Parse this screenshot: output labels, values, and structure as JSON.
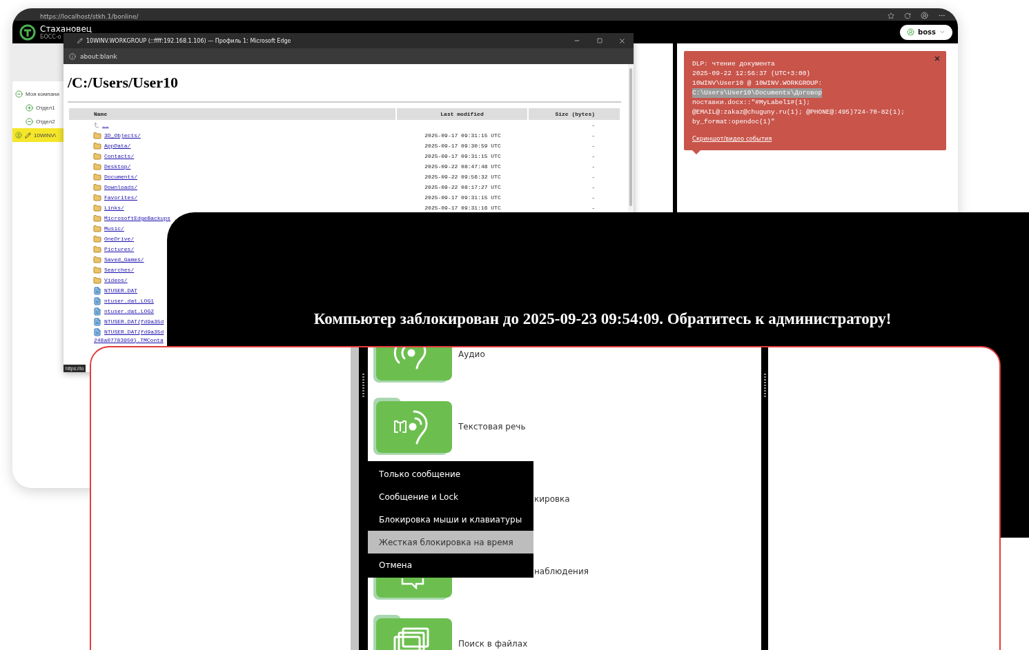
{
  "browser": {
    "url": "https://localhost/stkh.1/bonline/"
  },
  "app": {
    "name": "Стахановец",
    "subtitle": "БОСС-о",
    "user": "boss"
  },
  "tree": [
    {
      "label": "Моя компани",
      "expanded": true,
      "selected": false,
      "children": [
        {
          "label": "Отдел1",
          "expanded": false,
          "selected": false
        },
        {
          "label": "Отдел2",
          "expanded": true,
          "selected": false
        }
      ]
    },
    {
      "label": "10WINV\\",
      "kind": "computer",
      "selected": true
    }
  ],
  "notification": {
    "lines": [
      {
        "text": "DLP: чтение документа",
        "highlighted": false
      },
      {
        "text": "2025-09-22 12:56:37 (UTC+3:00)",
        "highlighted": false
      },
      {
        "text": "10WINV\\User10 @ 10WINV.WORKGROUP:",
        "highlighted": false
      },
      {
        "text": "C:\\Users\\User10\\Documents\\Договор",
        "highlighted": true
      },
      {
        "text": "поставки.docx::\"#MyLabel1#(1);",
        "highlighted": false
      },
      {
        "text": "@EMAIL@:zakaz@chuguny.ru(1); @PHONE@:495)724-70-82(1);",
        "highlighted": false
      },
      {
        "text": "by_format:opendoc(1)\"",
        "highlighted": false
      }
    ],
    "link": "Скриншот/видео события"
  },
  "edge": {
    "title": "10WINV.WORKGROUP (::ffff:192.168.1.106) — Профиль 1: Microsoft Edge",
    "address": "about:blank",
    "heading": "/C:/Users/User10",
    "status": "https://lo",
    "columns": [
      "Name",
      "Last modified",
      "Size (bytes)"
    ],
    "rows": [
      {
        "kind": "parent",
        "name": "..",
        "size": "-"
      },
      {
        "kind": "folder",
        "name": "3D_Objects/",
        "modified": "2025-09-17 09:31:15 UTC",
        "size": "-"
      },
      {
        "kind": "folder",
        "name": "AppData/",
        "modified": "2025-09-17 09:30:59 UTC",
        "size": "-"
      },
      {
        "kind": "folder",
        "name": "Contacts/",
        "modified": "2025-09-17 09:31:15 UTC",
        "size": "-"
      },
      {
        "kind": "folder",
        "name": "Desktop/",
        "modified": "2025-09-22 08:47:48 UTC",
        "size": "-"
      },
      {
        "kind": "folder",
        "name": "Documents/",
        "modified": "2025-09-22 09:56:32 UTC",
        "size": "-"
      },
      {
        "kind": "folder",
        "name": "Downloads/",
        "modified": "2025-09-22 08:17:27 UTC",
        "size": "-"
      },
      {
        "kind": "folder",
        "name": "Favorites/",
        "modified": "2025-09-17 09:31:15 UTC",
        "size": "-"
      },
      {
        "kind": "folder",
        "name": "Links/",
        "modified": "2025-09-17 09:31:16 UTC",
        "size": "-"
      },
      {
        "kind": "folder",
        "name": "MicrosoftEdgeBackups"
      },
      {
        "kind": "folder",
        "name": "Music/"
      },
      {
        "kind": "folder",
        "name": "OneDrive/"
      },
      {
        "kind": "folder",
        "name": "Pictures/"
      },
      {
        "kind": "folder",
        "name": "Saved_Games/"
      },
      {
        "kind": "folder",
        "name": "Searches/"
      },
      {
        "kind": "folder",
        "name": "Videos/"
      },
      {
        "kind": "file",
        "name": "NTUSER.DAT"
      },
      {
        "kind": "file",
        "name": "ntuser.dat.LOG1"
      },
      {
        "kind": "file",
        "name": "ntuser.dat.LOG2"
      },
      {
        "kind": "file",
        "name": "NTUSER.DAT{fd9a35d"
      },
      {
        "kind": "file",
        "name": "NTUSER.DAT{fd9a35d",
        "name_line_2": "248a07783950}.TMConta"
      }
    ]
  },
  "lock": {
    "message": "Компьютер заблокирован до 2025-09-23 09:54:09. Обратитесь к администратору!"
  },
  "features": [
    {
      "kind": "full",
      "label": "Аудио"
    },
    {
      "kind": "full",
      "label": "Текстовая речь"
    },
    {
      "kind": "hidden",
      "label": "кировка"
    },
    {
      "kind": "partial",
      "label": "наблюдения"
    },
    {
      "kind": "full",
      "label": "Поиск в файлах"
    }
  ],
  "menu": [
    {
      "label": "Только сообщение",
      "selected": false
    },
    {
      "label": "Сообщение и Lock",
      "selected": false
    },
    {
      "label": "Блокировка мыши и клавиатуры",
      "selected": false
    },
    {
      "label": "Жесткая блокировка на время",
      "selected": true
    },
    {
      "label": "Отмена",
      "selected": false
    }
  ]
}
